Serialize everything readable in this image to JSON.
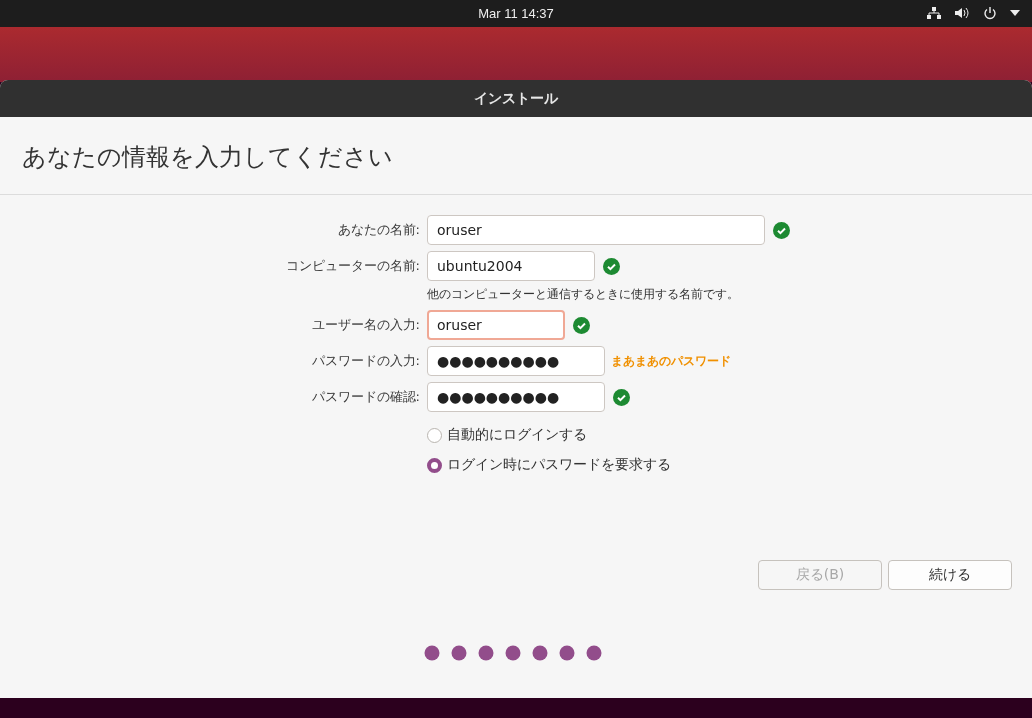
{
  "top_bar": {
    "clock": "Mar 11  14:37"
  },
  "window": {
    "title": "インストール"
  },
  "heading": "あなたの情報を入力してください",
  "fields": [
    {
      "label": "あなたの名前:",
      "value": "oruser",
      "focused": false,
      "status": {
        "kind": "check"
      }
    },
    {
      "label": "コンピューターの名前:",
      "value": "ubuntu2004",
      "focused": false,
      "status": {
        "kind": "check"
      },
      "hint": "他のコンピューターと通信するときに使用する名前です。"
    },
    {
      "label": "ユーザー名の入力:",
      "value": "oruser",
      "focused": true,
      "status": {
        "kind": "check"
      }
    },
    {
      "label": "パスワードの入力:",
      "value": "●●●●●●●●●●",
      "focused": false,
      "status": {
        "kind": "strength",
        "text": "まあまあのパスワード"
      }
    },
    {
      "label": "パスワードの確認:",
      "value": "●●●●●●●●●●",
      "focused": false,
      "status": {
        "kind": "check"
      }
    }
  ],
  "login_options": [
    {
      "label": "自動的にログインする",
      "selected": false
    },
    {
      "label": "ログイン時にパスワードを要求する",
      "selected": true
    }
  ],
  "buttons": [
    {
      "label": "戻る(B)",
      "disabled": true
    },
    {
      "label": "続ける",
      "disabled": false
    }
  ]
}
